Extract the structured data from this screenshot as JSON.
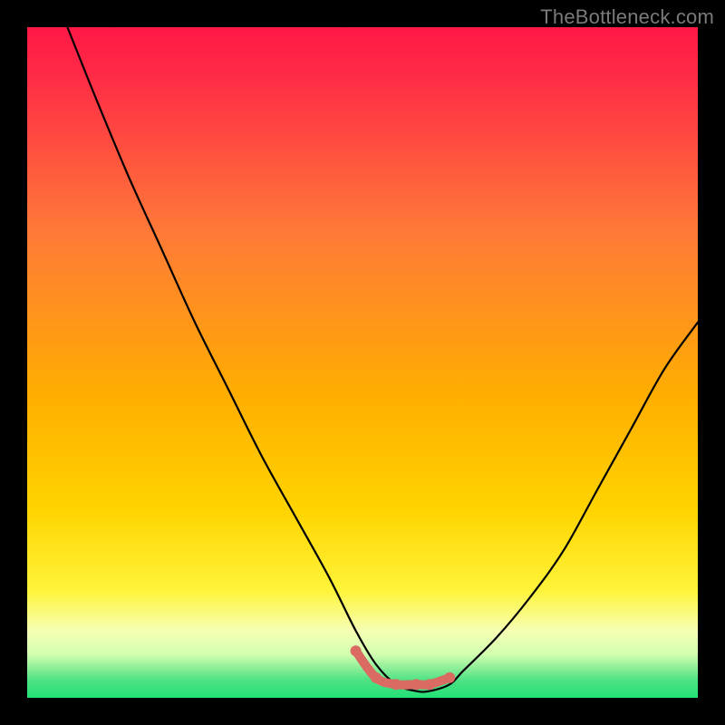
{
  "watermark": "TheBottleneck.com",
  "colors": {
    "bg": "#000000",
    "top": "#ff1846",
    "mid": "#ffae00",
    "low1": "#fff43a",
    "low2": "#f6ffb4",
    "bottom": "#23e178",
    "curve": "#000000",
    "marker": "#d96b63"
  },
  "chart_data": {
    "type": "line",
    "title": "",
    "xlabel": "",
    "ylabel": "",
    "xlim": [
      0,
      100
    ],
    "ylim": [
      0,
      100
    ],
    "grid": false,
    "annotations": [
      "TheBottleneck.com"
    ],
    "series": [
      {
        "name": "bottleneck-curve",
        "x": [
          6,
          10,
          15,
          20,
          25,
          30,
          35,
          40,
          45,
          49,
          52,
          55,
          58,
          60,
          63,
          65,
          70,
          75,
          80,
          85,
          90,
          95,
          100
        ],
        "y": [
          100,
          90,
          78,
          67,
          56,
          46,
          36,
          27,
          18,
          10,
          5,
          2,
          1,
          1,
          2,
          4,
          9,
          15,
          22,
          31,
          40,
          49,
          56
        ]
      },
      {
        "name": "optimal-range-marker",
        "x": [
          49,
          52,
          55,
          58,
          60,
          63
        ],
        "y": [
          7,
          3,
          2,
          2,
          2,
          3
        ]
      }
    ]
  }
}
